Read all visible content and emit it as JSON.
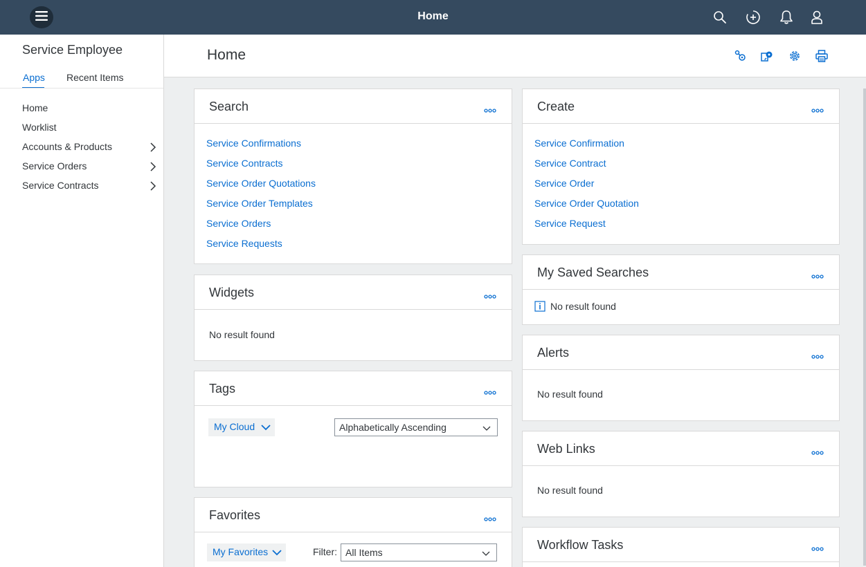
{
  "shell": {
    "title": "Home",
    "menu_icon": "hamburger-icon",
    "actions": [
      "search-icon",
      "add-circle-icon",
      "bell-icon",
      "user-icon"
    ]
  },
  "sidenav": {
    "app_title": "Service Employee",
    "tabs": [
      {
        "label": "Apps",
        "active": true
      },
      {
        "label": "Recent Items",
        "active": false
      }
    ],
    "items": [
      {
        "label": "Home",
        "has_children": false
      },
      {
        "label": "Worklist",
        "has_children": false
      },
      {
        "label": "Accounts & Products",
        "has_children": true
      },
      {
        "label": "Service Orders",
        "has_children": true
      },
      {
        "label": "Service Contracts",
        "has_children": true
      }
    ]
  },
  "page": {
    "title": "Home",
    "header_actions": [
      "network-icon",
      "personalize-icon",
      "settings-icon",
      "print-icon"
    ]
  },
  "cards": {
    "search": {
      "title": "Search",
      "links": [
        "Service Confirmations",
        "Service Contracts",
        "Service Order Quotations",
        "Service Order Templates",
        "Service Orders",
        "Service Requests"
      ]
    },
    "create": {
      "title": "Create",
      "links": [
        "Service Confirmation",
        "Service Contract",
        "Service Order",
        "Service Order Quotation",
        "Service Request"
      ]
    },
    "widgets": {
      "title": "Widgets",
      "message": "No result found"
    },
    "saved_searches": {
      "title": "My Saved Searches",
      "message": "No result found"
    },
    "tags": {
      "title": "Tags",
      "view_button": "My Cloud",
      "sort_select": "Alphabetically Ascending"
    },
    "alerts": {
      "title": "Alerts",
      "message": "No result found"
    },
    "web_links": {
      "title": "Web Links",
      "message": "No result found"
    },
    "favorites": {
      "title": "Favorites",
      "view_button": "My Favorites",
      "filter_label": "Filter:",
      "filter_select": "All Items"
    },
    "workflow_tasks": {
      "title": "Workflow Tasks"
    }
  },
  "colors": {
    "shell": "#354a5f",
    "accent": "#0a6ed1",
    "background": "#edeff0"
  }
}
